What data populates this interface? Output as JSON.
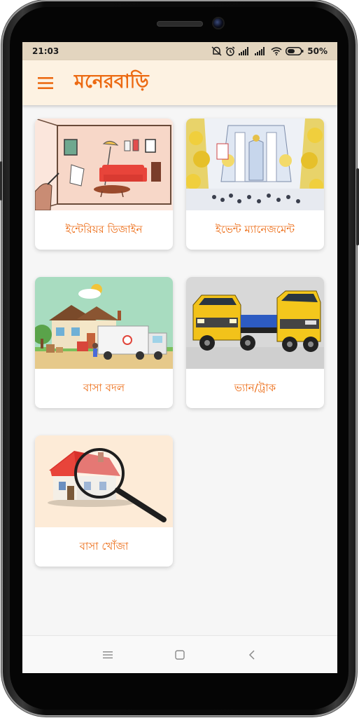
{
  "status_bar": {
    "time": "21:03",
    "battery": "50%",
    "icons": [
      "alarm-off-icon",
      "alarm-icon",
      "signal-icon",
      "signal-icon",
      "wifi-icon",
      "battery-icon"
    ]
  },
  "app_bar": {
    "title": "মনেরবাড়ি",
    "menu_icon": "hamburger-menu-icon",
    "accent_color": "#ec6a12",
    "background_color": "#fdf2e2"
  },
  "services": [
    {
      "label": "ইন্টেরিয়র ডিজাইন",
      "image": "interior-living-room-sketch"
    },
    {
      "label": "ইভেন্ট ম্যানেজমেন্ট",
      "image": "wedding-hall-event"
    },
    {
      "label": "বাসা বদল",
      "image": "house-moving-truck"
    },
    {
      "label": "ভ্যান/ট্রাক",
      "image": "yellow-trucks"
    },
    {
      "label": "বাসা খোঁজা",
      "image": "house-magnifying-glass"
    }
  ],
  "nav_bar": {
    "buttons": [
      "menu-lines-icon",
      "home-square-icon",
      "back-chevron-icon"
    ]
  }
}
